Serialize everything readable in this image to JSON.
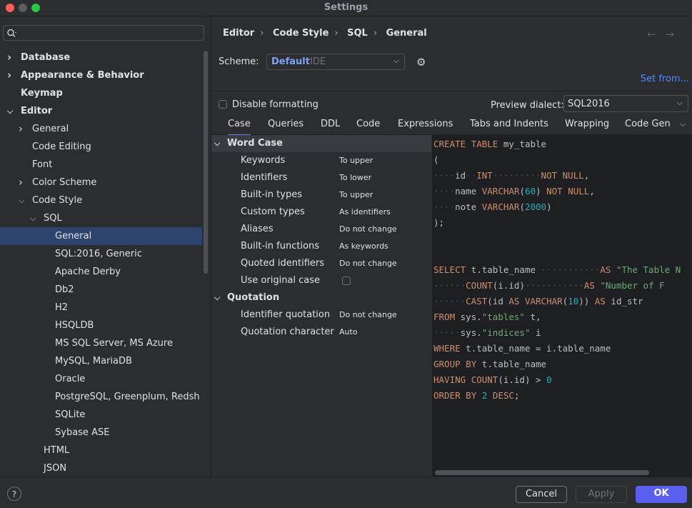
{
  "window": {
    "title": "Settings"
  },
  "search": {
    "value": ""
  },
  "tree": [
    {
      "label": "Database",
      "level": 0,
      "arrow": "right",
      "bold": true
    },
    {
      "label": "Appearance & Behavior",
      "level": 0,
      "arrow": "right",
      "bold": true
    },
    {
      "label": "Keymap",
      "level": 0,
      "arrow": "",
      "bold": true
    },
    {
      "label": "Editor",
      "level": 0,
      "arrow": "down",
      "bold": true
    },
    {
      "label": "General",
      "level": 1,
      "arrow": "right"
    },
    {
      "label": "Code Editing",
      "level": 1,
      "arrow": ""
    },
    {
      "label": "Font",
      "level": 1,
      "arrow": ""
    },
    {
      "label": "Color Scheme",
      "level": 1,
      "arrow": "right"
    },
    {
      "label": "Code Style",
      "level": 1,
      "arrow": "down"
    },
    {
      "label": "SQL",
      "level": 2,
      "arrow": "down"
    },
    {
      "label": "General",
      "level": 3,
      "arrow": "",
      "selected": true
    },
    {
      "label": "SQL:2016, Generic",
      "level": 3,
      "arrow": ""
    },
    {
      "label": "Apache Derby",
      "level": 3,
      "arrow": ""
    },
    {
      "label": "Db2",
      "level": 3,
      "arrow": ""
    },
    {
      "label": "H2",
      "level": 3,
      "arrow": ""
    },
    {
      "label": "HSQLDB",
      "level": 3,
      "arrow": ""
    },
    {
      "label": "MS SQL Server, MS Azure",
      "level": 3,
      "arrow": ""
    },
    {
      "label": "MySQL, MariaDB",
      "level": 3,
      "arrow": ""
    },
    {
      "label": "Oracle",
      "level": 3,
      "arrow": ""
    },
    {
      "label": "PostgreSQL, Greenplum, Redsh",
      "level": 3,
      "arrow": ""
    },
    {
      "label": "SQLite",
      "level": 3,
      "arrow": ""
    },
    {
      "label": "Sybase ASE",
      "level": 3,
      "arrow": ""
    },
    {
      "label": "HTML",
      "level": 2,
      "arrow": ""
    },
    {
      "label": "JSON",
      "level": 2,
      "arrow": ""
    }
  ],
  "breadcrumb": [
    "Editor",
    "Code Style",
    "SQL",
    "General"
  ],
  "scheme": {
    "label": "Scheme:",
    "value": "Default",
    "tag": "IDE"
  },
  "set_from": "Set from...",
  "disable_formatting": {
    "label": "Disable formatting",
    "checked": false
  },
  "preview_dialect": {
    "label": "Preview dialect:",
    "value": "SQL2016"
  },
  "tabs": [
    {
      "label": "Case",
      "active": true
    },
    {
      "label": "Queries"
    },
    {
      "label": "DDL"
    },
    {
      "label": "Code"
    },
    {
      "label": "Expressions"
    },
    {
      "label": "Tabs and Indents"
    },
    {
      "label": "Wrapping"
    },
    {
      "label": "Code Gen"
    }
  ],
  "word_case": {
    "title": "Word Case",
    "rows": [
      {
        "label": "Keywords",
        "value": "To upper"
      },
      {
        "label": "Identifiers",
        "value": "To lower"
      },
      {
        "label": "Built-in types",
        "value": "To upper"
      },
      {
        "label": "Custom types",
        "value": "As identifiers"
      },
      {
        "label": "Aliases",
        "value": "Do not change"
      },
      {
        "label": "Built-in functions",
        "value": "As keywords"
      },
      {
        "label": "Quoted identifiers",
        "value": "Do not change"
      },
      {
        "label": "Use original case",
        "value": ""
      }
    ]
  },
  "quotation": {
    "title": "Quotation",
    "rows": [
      {
        "label": "Identifier quotation",
        "value": "Do not change"
      },
      {
        "label": "Quotation character",
        "value": "Auto"
      }
    ]
  },
  "preview_code": [
    [
      [
        "kw",
        "CREATE"
      ],
      [
        "t",
        " "
      ],
      [
        "kw",
        "TABLE"
      ],
      [
        "t",
        " my_table"
      ]
    ],
    [
      [
        "t",
        "("
      ]
    ],
    [
      [
        "ws",
        "····"
      ],
      [
        "t",
        "id"
      ],
      [
        "ws",
        "··"
      ],
      [
        "kw",
        "INT"
      ],
      [
        "ws",
        "·········"
      ],
      [
        "kw",
        "NOT"
      ],
      [
        "t",
        " "
      ],
      [
        "kw",
        "NULL"
      ],
      [
        "t",
        ","
      ]
    ],
    [
      [
        "ws",
        "····"
      ],
      [
        "t",
        "name "
      ],
      [
        "kw",
        "VARCHAR"
      ],
      [
        "t",
        "("
      ],
      [
        "num",
        "60"
      ],
      [
        "t",
        ") "
      ],
      [
        "kw",
        "NOT"
      ],
      [
        "t",
        " "
      ],
      [
        "kw",
        "NULL"
      ],
      [
        "t",
        ","
      ]
    ],
    [
      [
        "ws",
        "····"
      ],
      [
        "t",
        "note "
      ],
      [
        "kw",
        "VARCHAR"
      ],
      [
        "t",
        "("
      ],
      [
        "num",
        "2000"
      ],
      [
        "t",
        ")"
      ]
    ],
    [
      [
        "t",
        ");"
      ]
    ],
    [
      [
        "t",
        ""
      ]
    ],
    [
      [
        "t",
        ""
      ]
    ],
    [
      [
        "kw",
        "SELECT"
      ],
      [
        "t",
        " t.table_name "
      ],
      [
        "ws",
        "···········"
      ],
      [
        "kw",
        "AS"
      ],
      [
        "t",
        " "
      ],
      [
        "str",
        "\"The Table N"
      ]
    ],
    [
      [
        "ws",
        "······"
      ],
      [
        "kw",
        "COUNT"
      ],
      [
        "t",
        "(i.id)"
      ],
      [
        "ws",
        "···········"
      ],
      [
        "kw",
        "AS"
      ],
      [
        "t",
        " "
      ],
      [
        "str",
        "\"Number of F"
      ]
    ],
    [
      [
        "ws",
        "······"
      ],
      [
        "kw",
        "CAST"
      ],
      [
        "t",
        "(id "
      ],
      [
        "kw",
        "AS"
      ],
      [
        "t",
        " "
      ],
      [
        "kw",
        "VARCHAR"
      ],
      [
        "t",
        "("
      ],
      [
        "num",
        "10"
      ],
      [
        "t",
        ")) "
      ],
      [
        "kw",
        "AS"
      ],
      [
        "t",
        " id_str"
      ]
    ],
    [
      [
        "kw",
        "FROM"
      ],
      [
        "t",
        " sys."
      ],
      [
        "str",
        "\"tables\""
      ],
      [
        "t",
        " t,"
      ]
    ],
    [
      [
        "ws",
        "·····"
      ],
      [
        "t",
        "sys."
      ],
      [
        "str",
        "\"indices\""
      ],
      [
        "t",
        " i"
      ]
    ],
    [
      [
        "kw",
        "WHERE"
      ],
      [
        "t",
        " t.table_name = i.table_name"
      ]
    ],
    [
      [
        "kw",
        "GROUP"
      ],
      [
        "t",
        " "
      ],
      [
        "kw",
        "BY"
      ],
      [
        "t",
        " t.table_name"
      ]
    ],
    [
      [
        "kw",
        "HAVING"
      ],
      [
        "t",
        " "
      ],
      [
        "kw",
        "COUNT"
      ],
      [
        "t",
        "(i.id) > "
      ],
      [
        "num",
        "0"
      ]
    ],
    [
      [
        "kw",
        "ORDER"
      ],
      [
        "t",
        " "
      ],
      [
        "kw",
        "BY"
      ],
      [
        "t",
        " "
      ],
      [
        "num",
        "2"
      ],
      [
        "t",
        " "
      ],
      [
        "kw",
        "DESC"
      ],
      [
        "t",
        ";"
      ]
    ]
  ],
  "footer": {
    "help": "?",
    "cancel": "Cancel",
    "apply": "Apply",
    "ok": "OK"
  },
  "colors": {
    "accent": "#548af7",
    "selection": "#2e436e",
    "ok_button": "#5a5ff0",
    "keyword": "#cf8e6d",
    "number": "#2aacb8",
    "string": "#6aab73"
  }
}
